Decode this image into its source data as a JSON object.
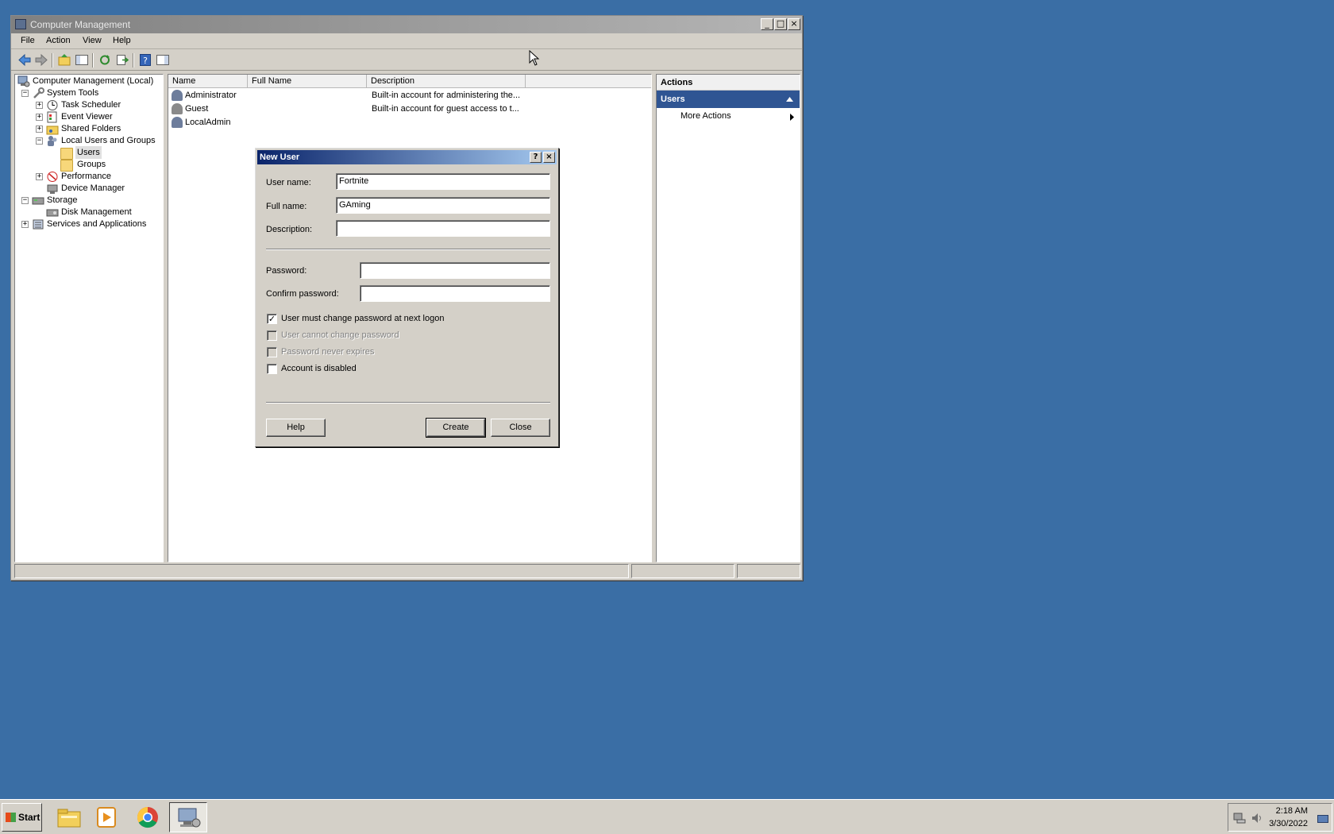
{
  "window": {
    "title": "Computer Management",
    "minimize": "_",
    "maximize": "□",
    "close": "×"
  },
  "menu": [
    "File",
    "Action",
    "View",
    "Help"
  ],
  "tree": [
    {
      "label": "Computer Management (Local)"
    },
    {
      "label": "System Tools",
      "expander": "−"
    },
    {
      "label": "Task Scheduler",
      "expander": "+"
    },
    {
      "label": "Event Viewer",
      "expander": "+"
    },
    {
      "label": "Shared Folders",
      "expander": "+"
    },
    {
      "label": "Local Users and Groups",
      "expander": "−"
    },
    {
      "label": "Users"
    },
    {
      "label": "Groups"
    },
    {
      "label": "Performance",
      "expander": "+"
    },
    {
      "label": "Device Manager"
    },
    {
      "label": "Storage",
      "expander": "−"
    },
    {
      "label": "Disk Management"
    },
    {
      "label": "Services and Applications",
      "expander": "+"
    }
  ],
  "list": {
    "columns": [
      "Name",
      "Full Name",
      "Description"
    ],
    "rows": [
      {
        "name": "Administrator",
        "full_name": "",
        "description": "Built-in account for administering the..."
      },
      {
        "name": "Guest",
        "full_name": "",
        "description": "Built-in account for guest access to t..."
      },
      {
        "name": "LocalAdmin",
        "full_name": "",
        "description": ""
      }
    ]
  },
  "actions": {
    "header": "Actions",
    "section": "Users",
    "more": "More Actions"
  },
  "dialog": {
    "title": "New User",
    "help_glyph": "?",
    "close_glyph": "×",
    "username_label": "User name:",
    "username_value": "Fortnite",
    "fullname_label": "Full name:",
    "fullname_value": "GAming",
    "description_label": "Description:",
    "description_value": "",
    "password_label": "Password:",
    "confirm_label": "Confirm password:",
    "check_must_change": "User must change password at next logon",
    "check_cannot_change": "User cannot change password",
    "check_never_expires": "Password never expires",
    "check_disabled": "Account is disabled",
    "checkmark": "✓",
    "help_button": "Help",
    "create_button": "Create",
    "close_button": "Close"
  },
  "taskbar": {
    "start": "Start",
    "time": "2:18 AM",
    "date": "3/30/2022"
  }
}
